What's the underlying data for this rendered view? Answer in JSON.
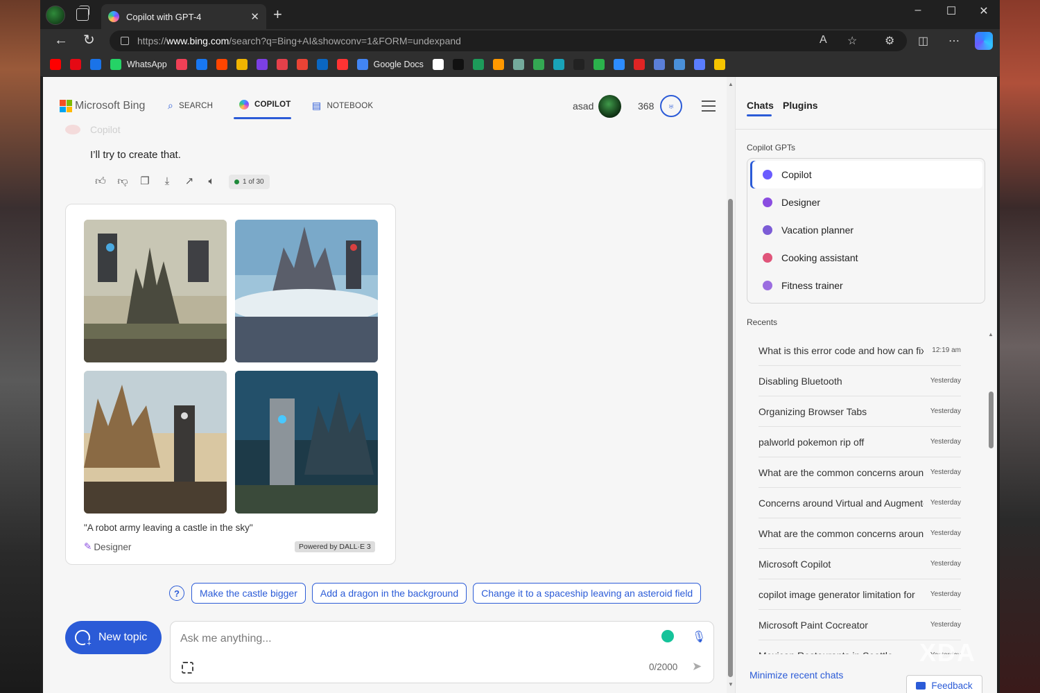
{
  "browser": {
    "tab_title": "Copilot with GPT-4",
    "url_prefix": "https://",
    "url_host": "www.bing.com",
    "url_path": "/search?q=Bing+AI&showconv=1&FORM=undexpand",
    "window_controls": [
      "–",
      "☐",
      "✕"
    ]
  },
  "favorites": [
    {
      "label": "",
      "color": "#ff0000"
    },
    {
      "label": "",
      "color": "#e50914"
    },
    {
      "label": "",
      "color": "#1a73e8"
    },
    {
      "label": "WhatsApp",
      "color": "#25d366"
    },
    {
      "label": "",
      "color": "#ef4056"
    },
    {
      "label": "",
      "color": "#1877f2"
    },
    {
      "label": "",
      "color": "#ff4500"
    },
    {
      "label": "",
      "color": "#f0b400"
    },
    {
      "label": "",
      "color": "#7b3fe4"
    },
    {
      "label": "",
      "color": "#e5404a"
    },
    {
      "label": "",
      "color": "#ea4335"
    },
    {
      "label": "",
      "color": "#0a66c2"
    },
    {
      "label": "",
      "color": "#ff3333"
    },
    {
      "label": "Google Docs",
      "color": "#4285f4"
    },
    {
      "label": "",
      "color": "#ffffff"
    },
    {
      "label": "",
      "color": "#111111"
    },
    {
      "label": "",
      "color": "#1d9b5a"
    },
    {
      "label": "",
      "color": "#ff9900"
    },
    {
      "label": "",
      "color": "#74aa9c"
    },
    {
      "label": "",
      "color": "#34a853"
    },
    {
      "label": "",
      "color": "#19a3b8"
    },
    {
      "label": "",
      "color": "#222222"
    },
    {
      "label": "",
      "color": "#2bb24c"
    },
    {
      "label": "",
      "color": "#2d8cff"
    },
    {
      "label": "",
      "color": "#e02424"
    },
    {
      "label": "",
      "color": "#5b7fd8"
    },
    {
      "label": "",
      "color": "#4a90d9"
    },
    {
      "label": "",
      "color": "#5a7dff"
    },
    {
      "label": "",
      "color": "#f5c400"
    }
  ],
  "header": {
    "brand": "Microsoft Bing",
    "nav": [
      {
        "label": "SEARCH"
      },
      {
        "label": "COPILOT"
      },
      {
        "label": "NOTEBOOK"
      }
    ],
    "user": "asad",
    "points": "368"
  },
  "conversation": {
    "sender_faded": "Copilot",
    "message": "I’ll try to create that.",
    "counter": "1 of 30",
    "caption": "\"A robot army leaving a castle in the sky\"",
    "designer_label": "Designer",
    "powered_by": "Powered by DALL·E 3"
  },
  "suggestions": [
    "Make the castle bigger",
    "Add a dragon in the background",
    "Change it to a spaceship leaving an asteroid field"
  ],
  "composer": {
    "new_topic": "New topic",
    "placeholder": "Ask me anything...",
    "char_count": "0/2000"
  },
  "sidebar": {
    "tabs": [
      "Chats",
      "Plugins"
    ],
    "gpts_label": "Copilot GPTs",
    "gpts": [
      {
        "label": "Copilot",
        "color": "#6a5cff"
      },
      {
        "label": "Designer",
        "color": "#8a4de0"
      },
      {
        "label": "Vacation planner",
        "color": "#7c5cd6"
      },
      {
        "label": "Cooking assistant",
        "color": "#e0557a"
      },
      {
        "label": "Fitness trainer",
        "color": "#9b6de0"
      }
    ],
    "recents_label": "Recents",
    "recents": [
      {
        "title": "What is this error code and how can fix",
        "time": "12:19 am"
      },
      {
        "title": "Disabling Bluetooth",
        "time": "Yesterday"
      },
      {
        "title": "Organizing Browser Tabs",
        "time": "Yesterday"
      },
      {
        "title": "palworld pokemon rip off",
        "time": "Yesterday"
      },
      {
        "title": "What are the common concerns around",
        "time": "Yesterday"
      },
      {
        "title": "Concerns around Virtual and Augmented",
        "time": "Yesterday"
      },
      {
        "title": "What are the common concerns around",
        "time": "Yesterday"
      },
      {
        "title": "Microsoft Copilot",
        "time": "Yesterday"
      },
      {
        "title": "copilot image generator limitation for",
        "time": "Yesterday"
      },
      {
        "title": "Microsoft Paint Cocreator",
        "time": "Yesterday"
      },
      {
        "title": "Mexican Restaurants in Seattle",
        "time": "Yesterday"
      }
    ],
    "minimize": "Minimize recent chats",
    "feedback": "Feedback"
  },
  "watermark": "XDA"
}
